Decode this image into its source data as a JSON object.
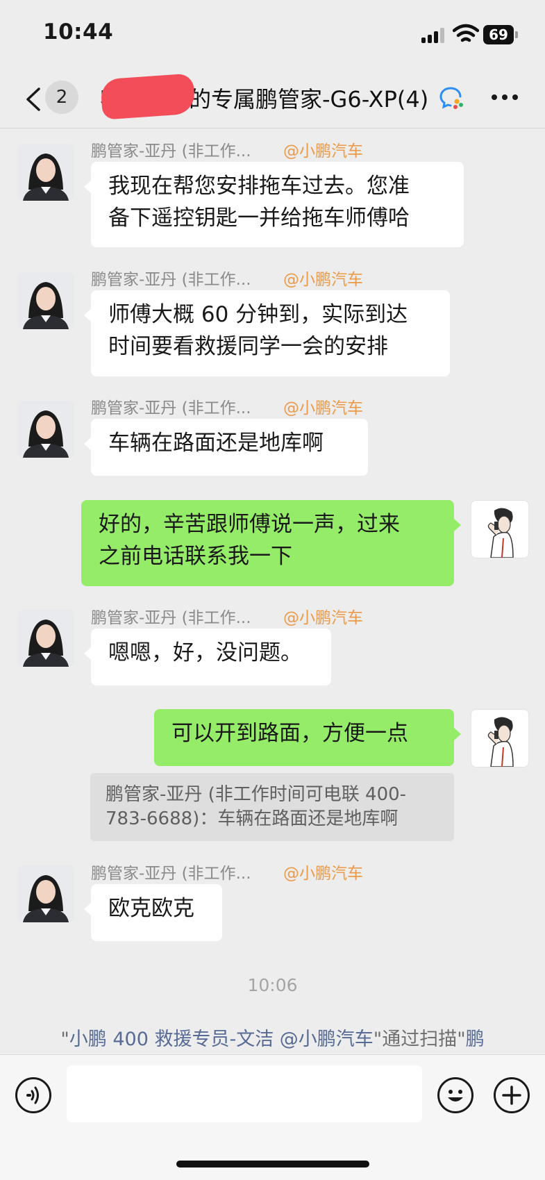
{
  "status_bar": {
    "time": "10:44",
    "battery": "69"
  },
  "header": {
    "unread_count": "2",
    "title_visible": "客　　　的专属鹏管家-G6-XP",
    "member_count": "(4)"
  },
  "messages": [
    {
      "sender": "鹏管家-亚丹 (非工作...",
      "tag": "@小鹏汽车",
      "lines": [
        "我现在帮您安排拖车过去。您准",
        "备下遥控钥匙一并给拖车师傅哈"
      ]
    },
    {
      "sender": "鹏管家-亚丹 (非工作...",
      "tag": "@小鹏汽车",
      "lines": [
        "师傅大概 60 分钟到，实际到达",
        "时间要看救援同学一会的安排"
      ]
    },
    {
      "sender": "鹏管家-亚丹 (非工作...",
      "tag": "@小鹏汽车",
      "lines": [
        "车辆在路面还是地库啊"
      ]
    },
    {
      "lines": [
        "好的，辛苦跟师傅说一声，过来",
        "之前电话联系我一下"
      ]
    },
    {
      "sender": "鹏管家-亚丹 (非工作...",
      "tag": "@小鹏汽车",
      "lines": [
        "嗯嗯，好，没问题。"
      ]
    },
    {
      "lines": [
        "可以开到路面，方便一点"
      ]
    },
    {
      "sender": "鹏管家-亚丹 (非工作...",
      "tag": "@小鹏汽车",
      "lines": [
        "欧克欧克"
      ]
    }
  ],
  "quote": {
    "lines": [
      "鹏管家-亚丹 (非工作时间可电联 400-",
      "783-6688)：车辆在路面还是地库啊"
    ]
  },
  "timestamp": "10:06",
  "system_notice": {
    "q1": "\"",
    "name": "小鹏 400 救援专员-文洁 @小鹏汽车",
    "mid": "\"通过扫描\"",
    "tail": "鹏"
  },
  "input": {
    "value": ""
  }
}
